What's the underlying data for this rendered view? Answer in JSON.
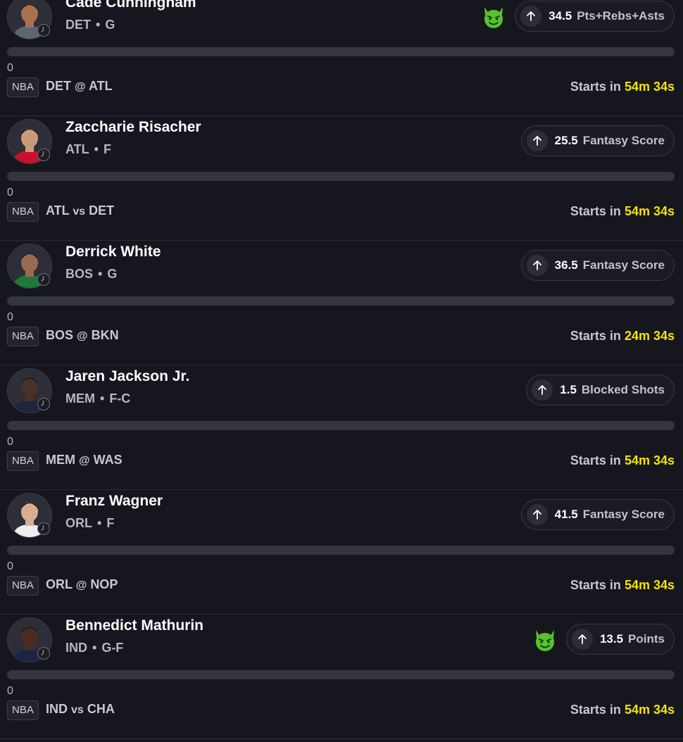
{
  "colors": {
    "background": "#16161f",
    "countdown": "#f4e400",
    "demon": "#58c22c"
  },
  "projections": [
    {
      "name": "Cade Cunningham",
      "team": "DET",
      "position": "G",
      "line": "34.5",
      "stat": "Pts+Rebs+Asts",
      "demon": true,
      "progress": "0",
      "league": "NBA",
      "team_a": "DET",
      "separator": "@",
      "team_b": "ATL",
      "starts_label": "Starts in",
      "countdown": "54m 34s",
      "skin": "#a8704e",
      "jersey": "#5d6570"
    },
    {
      "name": "Zaccharie Risacher",
      "team": "ATL",
      "position": "F",
      "line": "25.5",
      "stat": "Fantasy Score",
      "demon": false,
      "progress": "0",
      "league": "NBA",
      "team_a": "ATL",
      "separator": "vs",
      "team_b": "DET",
      "starts_label": "Starts in",
      "countdown": "54m 34s",
      "skin": "#c99a7a",
      "jersey": "#c8102e"
    },
    {
      "name": "Derrick White",
      "team": "BOS",
      "position": "G",
      "line": "36.5",
      "stat": "Fantasy Score",
      "demon": false,
      "progress": "0",
      "league": "NBA",
      "team_a": "BOS",
      "separator": "@",
      "team_b": "BKN",
      "starts_label": "Starts in",
      "countdown": "24m 34s",
      "skin": "#9a6a50",
      "jersey": "#1f7a3a"
    },
    {
      "name": "Jaren Jackson Jr.",
      "team": "MEM",
      "position": "F-C",
      "line": "1.5",
      "stat": "Blocked Shots",
      "demon": false,
      "progress": "0",
      "league": "NBA",
      "team_a": "MEM",
      "separator": "@",
      "team_b": "WAS",
      "starts_label": "Starts in",
      "countdown": "54m 34s",
      "skin": "#4a3026",
      "jersey": "#1d2540"
    },
    {
      "name": "Franz Wagner",
      "team": "ORL",
      "position": "F",
      "line": "41.5",
      "stat": "Fantasy Score",
      "demon": false,
      "progress": "0",
      "league": "NBA",
      "team_a": "ORL",
      "separator": "@",
      "team_b": "NOP",
      "starts_label": "Starts in",
      "countdown": "54m 34s",
      "skin": "#d8ad92",
      "jersey": "#eeeeee"
    },
    {
      "name": "Bennedict Mathurin",
      "team": "IND",
      "position": "G-F",
      "line": "13.5",
      "stat": "Points",
      "demon": true,
      "progress": "0",
      "league": "NBA",
      "team_a": "IND",
      "separator": "vs",
      "team_b": "CHA",
      "starts_label": "Starts in",
      "countdown": "54m 34s",
      "skin": "#4a2c22",
      "jersey": "#1b2444"
    }
  ]
}
